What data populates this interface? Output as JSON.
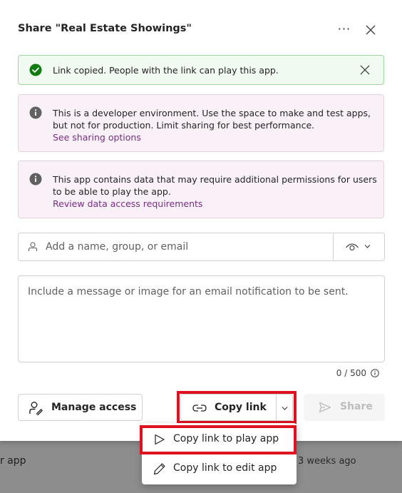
{
  "background": {
    "app_fragment": "r app",
    "time_fragment": "3 weeks ago"
  },
  "dialog": {
    "title": "Share \"Real Estate Showings\"",
    "more_label": "···",
    "success_banner": {
      "message": "Link copied. People with the link can play this app."
    },
    "info_banner_1": {
      "message": "This is a developer environment. Use the space to make and test apps, but not for production. Limit sharing for best performance.",
      "link": "See sharing options"
    },
    "info_banner_2": {
      "message": "This app contains data that may require additional permissions for users to be able to play the app.",
      "link": "Review data access requirements"
    },
    "people_input": {
      "placeholder": "Add a name, group, or email",
      "value": ""
    },
    "message_input": {
      "placeholder": "Include a message or image for an email notification to be sent.",
      "value": ""
    },
    "counter": "0 / 500",
    "buttons": {
      "manage_access": "Manage access",
      "copy_link": "Copy link",
      "share": "Share"
    }
  },
  "copy_menu": {
    "items": [
      {
        "label": "Copy link to play app",
        "icon": "play-icon"
      },
      {
        "label": "Copy link to edit app",
        "icon": "pencil-icon"
      }
    ]
  },
  "colors": {
    "success_green": "#107c10",
    "info_icon": "#616161",
    "link_purple": "#7a2c86",
    "highlight_red": "#e0121f"
  }
}
